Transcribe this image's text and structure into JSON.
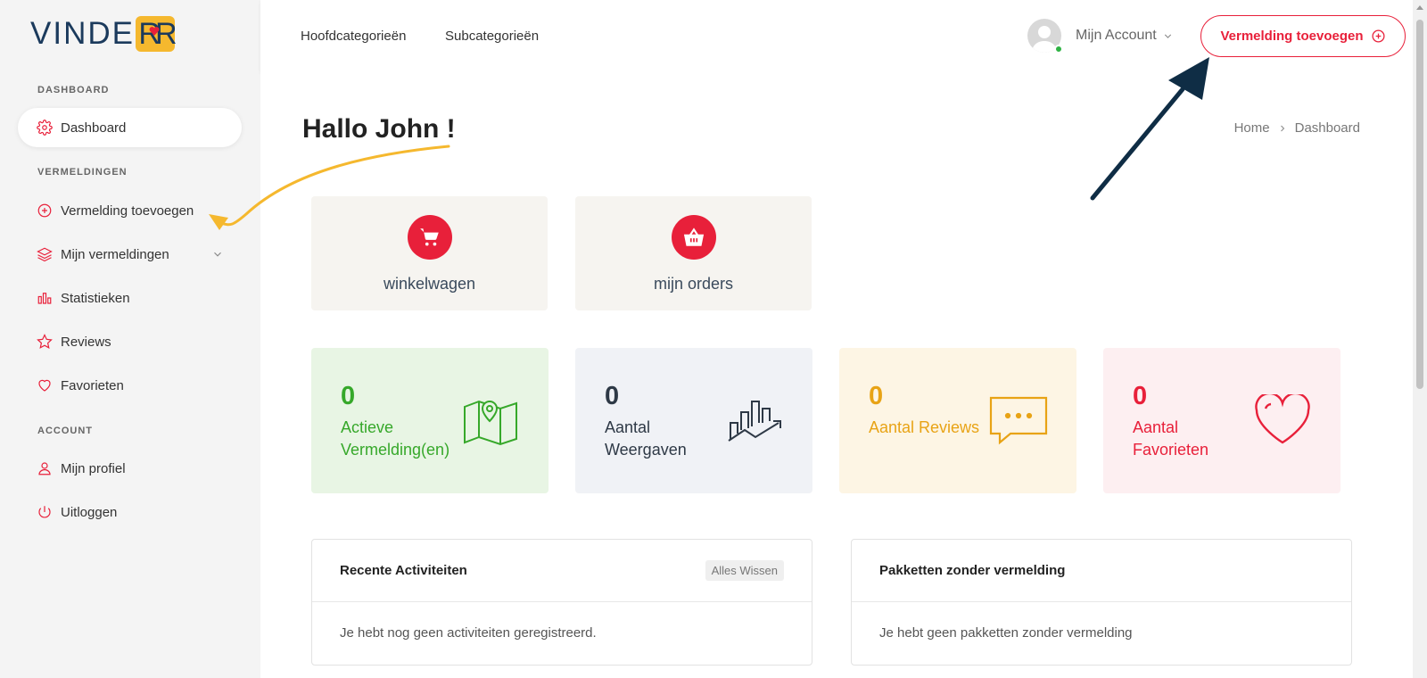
{
  "sidebar": {
    "logo_text": "VINDE",
    "logo_box_text": "RR",
    "sections": {
      "dashboard": "DASHBOARD",
      "listings": "VERMELDINGEN",
      "account": "ACCOUNT"
    },
    "items": [
      {
        "label": "Dashboard",
        "icon": "gear-icon"
      },
      {
        "label": "Vermelding toevoegen",
        "icon": "plus-circle-icon"
      },
      {
        "label": "Mijn vermeldingen",
        "icon": "layers-icon"
      },
      {
        "label": "Statistieken",
        "icon": "bar-chart-icon"
      },
      {
        "label": "Reviews",
        "icon": "star-icon"
      },
      {
        "label": "Favorieten",
        "icon": "heart-icon"
      },
      {
        "label": "Mijn profiel",
        "icon": "user-icon"
      },
      {
        "label": "Uitloggen",
        "icon": "power-icon"
      }
    ]
  },
  "header": {
    "nav": [
      "Hoofdcategorieën",
      "Subcategorieën"
    ],
    "account_label": "Mijn Account",
    "add_button": "Vermelding toevoegen"
  },
  "main": {
    "greeting": "Hallo John !",
    "breadcrumb": [
      "Home",
      "Dashboard"
    ],
    "quick_cards": [
      {
        "label": "winkelwagen",
        "icon": "cart-icon"
      },
      {
        "label": "mijn orders",
        "icon": "basket-icon"
      }
    ],
    "stats": [
      {
        "value": "0",
        "label": "Actieve Vermelding(en)",
        "color": "#36a82a",
        "bg": "#e8f5e4",
        "icon": "map-pin-icon"
      },
      {
        "value": "0",
        "label": "Aantal Weergaven",
        "color": "#2e3946",
        "bg": "#f0f2f6",
        "icon": "growth-chart-icon"
      },
      {
        "value": "0",
        "label": "Aantal Reviews",
        "color": "#e8a315",
        "bg": "#fdf5e4",
        "icon": "chat-bubble-icon"
      },
      {
        "value": "0",
        "label": "Aantal Favorieten",
        "color": "#e8203a",
        "bg": "#fdeff1",
        "icon": "heart-outline-icon"
      }
    ],
    "panels": [
      {
        "title": "Recente Activiteiten",
        "button": "Alles Wissen",
        "body": "Je hebt nog geen activiteiten geregistreerd."
      },
      {
        "title": "Pakketten zonder vermelding",
        "body": "Je hebt geen pakketten zonder vermelding"
      }
    ]
  },
  "colors": {
    "accent": "#e8203a",
    "brand_navy": "#1b3a5c",
    "brand_yellow": "#f5b82e",
    "arrow_navy": "#0f2d45",
    "arrow_yellow": "#f5b82e"
  }
}
